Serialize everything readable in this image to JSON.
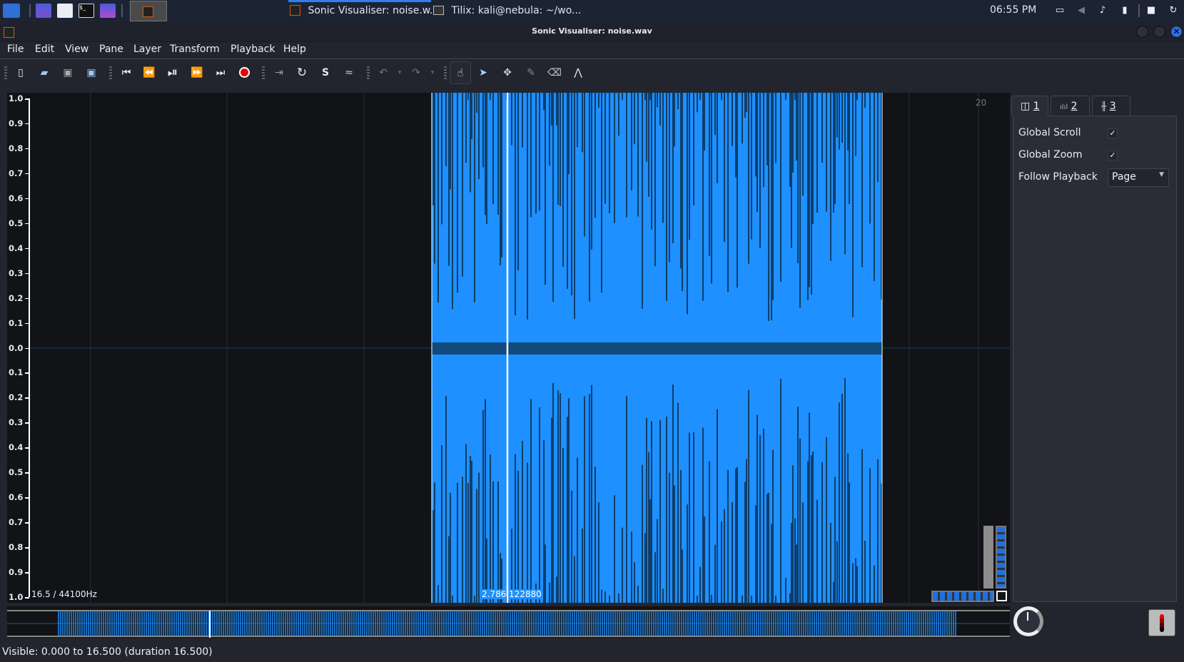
{
  "taskbar": {
    "launchers": [
      "kali-menu-icon",
      "desktop-icon",
      "file-manager-icon",
      "terminal-icon",
      "screen-recorder-icon"
    ],
    "tasks": [
      {
        "label": "Sonic Visualiser: noise.w...",
        "active": true
      },
      {
        "label": "Tilix: kali@nebula: ~/wo..."
      }
    ],
    "clock": "06:55 PM"
  },
  "window": {
    "title": "Sonic Visualiser: noise.wav"
  },
  "menu": [
    "File",
    "Edit",
    "View",
    "Pane",
    "Layer",
    "Transform",
    "Playback",
    "Help"
  ],
  "toolbar": {
    "groups": [
      [
        "new-file",
        "open-file",
        "save-file",
        "save-as"
      ],
      [
        "rewind-start",
        "rewind",
        "play-pause",
        "fast-forward",
        "fast-forward-end",
        "record"
      ],
      [
        "play-selection",
        "loop",
        "solo",
        "follow-sync"
      ],
      [
        "undo",
        "redo"
      ],
      [
        "navigate",
        "select",
        "move",
        "draw",
        "erase",
        "measure"
      ]
    ]
  },
  "pane": {
    "y_axis_labels": [
      "1.0",
      "0.9",
      "0.8",
      "0.7",
      "0.6",
      "0.5",
      "0.4",
      "0.3",
      "0.2",
      "0.1",
      "0.0",
      "0.1",
      "0.2",
      "0.3",
      "0.4",
      "0.5",
      "0.6",
      "0.7",
      "0.8",
      "0.9",
      "1.0"
    ],
    "time_labels": [
      "20"
    ],
    "info_left": "16.5 / 44100Hz",
    "playhead_time": "2.786",
    "playhead_frame": "122880",
    "waveform_color": "#1e90ff",
    "background": "#121316"
  },
  "properties": {
    "tabs": [
      {
        "label": "1",
        "icon": "pane-icon"
      },
      {
        "label": "2",
        "icon": "spectrum-icon"
      },
      {
        "label": "3",
        "icon": "waveform-icon"
      }
    ],
    "global_scroll": {
      "label": "Global Scroll",
      "checked": true,
      "mark": "✓"
    },
    "global_zoom": {
      "label": "Global Zoom",
      "checked": true,
      "mark": "✓"
    },
    "follow_playback": {
      "label": "Follow Playback",
      "value": "Page"
    }
  },
  "status": "Visible: 0.000 to 16.500 (duration 16.500)"
}
